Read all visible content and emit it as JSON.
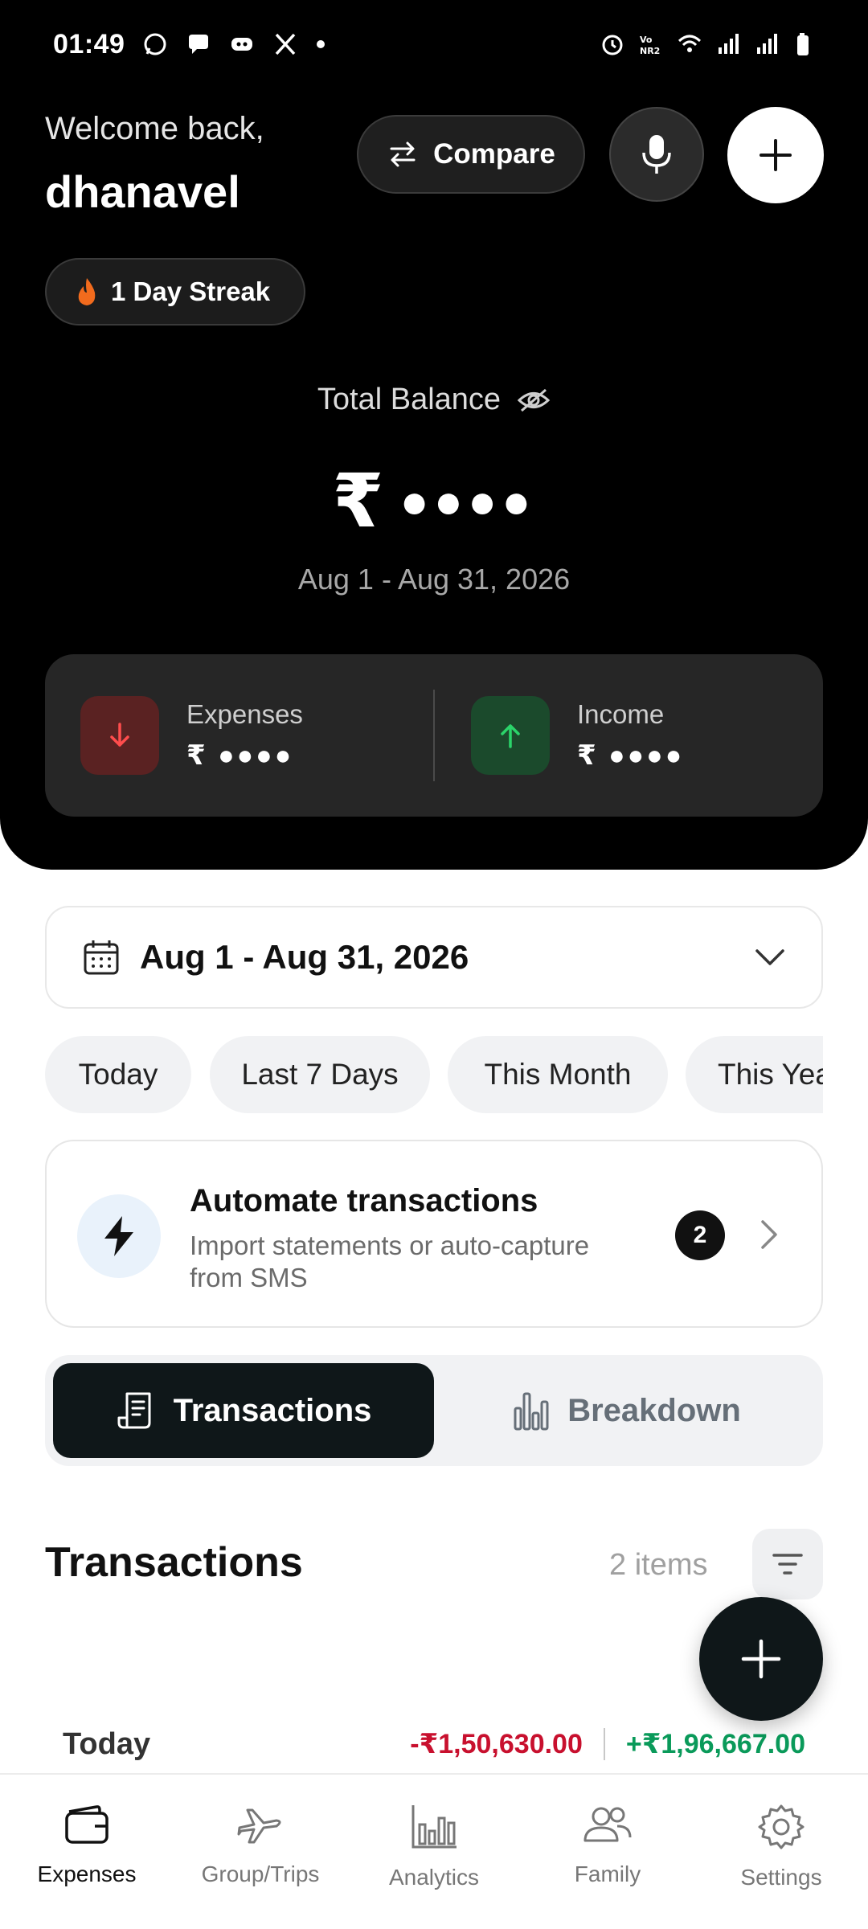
{
  "status_bar": {
    "time": "01:49"
  },
  "header": {
    "welcome": "Welcome back,",
    "username": "dhanavel",
    "compare_label": "Compare",
    "streak_label": "1 Day Streak"
  },
  "balance": {
    "label": "Total Balance",
    "currency": "₹",
    "masked": "●●●●",
    "date_range": "Aug 1 - Aug 31, 2026"
  },
  "summary": {
    "expenses_label": "Expenses",
    "expenses_value": "₹ ●●●●",
    "income_label": "Income",
    "income_value": "₹ ●●●●"
  },
  "date_selector": {
    "value": "Aug 1 - Aug 31, 2026"
  },
  "quick_ranges": [
    "Today",
    "Last 7 Days",
    "This Month",
    "This Year"
  ],
  "automate": {
    "title": "Automate transactions",
    "subtitle": "Import statements or auto-capture from SMS",
    "badge": "2"
  },
  "segment": {
    "active": "Transactions",
    "inactive": "Breakdown"
  },
  "transactions": {
    "title": "Transactions",
    "count": "2 items",
    "groups": [
      {
        "label": "Today",
        "expense": "-₹1,50,630.00",
        "income": "+₹1,96,667.00"
      }
    ]
  },
  "nav": {
    "items": [
      {
        "label": "Expenses"
      },
      {
        "label": "Group/Trips"
      },
      {
        "label": "Analytics"
      },
      {
        "label": "Family"
      },
      {
        "label": "Settings"
      }
    ]
  },
  "colors": {
    "expense_red": "#c8102e",
    "income_green": "#0a9a5a",
    "dark": "#0f1719"
  }
}
